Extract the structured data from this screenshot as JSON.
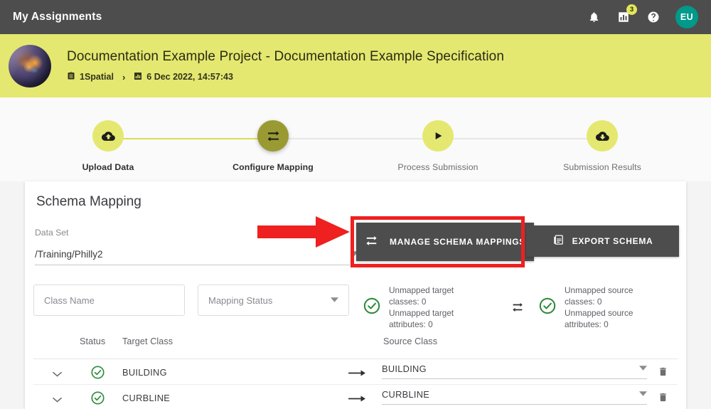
{
  "appbar": {
    "title": "My Assignments",
    "notifications_icon": "bell-icon",
    "reports_icon": "bar-chart-icon",
    "reports_badge": "3",
    "help_icon": "help-circle-icon",
    "avatar_initials": "EU",
    "avatar_color": "#00998a"
  },
  "banner": {
    "background_color": "#e4e870",
    "avatar_icon": "globe-avatar",
    "project_title": "Documentation Example Project - Documentation Example Specification",
    "breadcrumb": {
      "org_icon": "clipboard-icon",
      "org": "1Spatial",
      "separator": "›",
      "date_icon": "bar-chart-icon",
      "date": "6 Dec 2022, 14:57:43"
    }
  },
  "stepper": {
    "steps": [
      {
        "label": "Upload Data",
        "icon": "cloud-upload-icon",
        "state": "done"
      },
      {
        "label": "Configure Mapping",
        "icon": "swap-horizontal-icon",
        "state": "active"
      },
      {
        "label": "Process Submission",
        "icon": "play-icon",
        "state": "upcoming"
      },
      {
        "label": "Submission Results",
        "icon": "cloud-download-icon",
        "state": "upcoming"
      }
    ]
  },
  "card": {
    "title": "Schema Mapping",
    "dataset": {
      "label": "Data Set",
      "value": "/Training/Philly2",
      "caret_icon": "chevron-down-icon"
    },
    "manage_button": {
      "label": "MANAGE SCHEMA MAPPINGS",
      "icon": "swap-horizontal-icon",
      "highlight_color": "#ee2020"
    },
    "export_button": {
      "label": "EXPORT SCHEMA",
      "icon": "export-document-icon"
    },
    "annotation": {
      "arrow_icon": "red-arrow-right",
      "color": "#ee2020"
    },
    "filters": {
      "class_name_placeholder": "Class Name",
      "class_name_value": "",
      "mapping_status_placeholder": "Mapping Status",
      "mapping_status_value": "",
      "mapping_status_caret": "chevron-down-icon"
    },
    "summary": {
      "target": {
        "status_icon": "check-circle-icon",
        "line1": "Unmapped target classes: 0",
        "line2": "Unmapped target attributes: 0"
      },
      "middle_icon": "swap-horizontal-icon",
      "source": {
        "status_icon": "check-circle-icon",
        "line1": "Unmapped source classes: 0",
        "line2": "Unmapped source attributes: 0"
      }
    },
    "table": {
      "headers": {
        "expand": "",
        "status": "Status",
        "target_class": "Target Class",
        "source_class": "Source Class"
      },
      "rows": [
        {
          "expand_icon": "chevron-down-icon",
          "status_icon": "check-circle-icon",
          "target_class": "BUILDING",
          "map_icon": "arrow-right-icon",
          "source_class": "BUILDING",
          "source_caret": "chevron-down-icon",
          "delete_icon": "trash-icon"
        },
        {
          "expand_icon": "chevron-down-icon",
          "status_icon": "check-circle-icon",
          "target_class": "CURBLINE",
          "map_icon": "arrow-right-icon",
          "source_class": "CURBLINE",
          "source_caret": "chevron-down-icon",
          "delete_icon": "trash-icon"
        }
      ]
    }
  },
  "colors": {
    "appbar": "#4d4d4d",
    "accent_yellow": "#e4e870",
    "accent_olive": "#9a9a33",
    "success_green": "#2e8b3d",
    "annotation_red": "#ee2020"
  }
}
